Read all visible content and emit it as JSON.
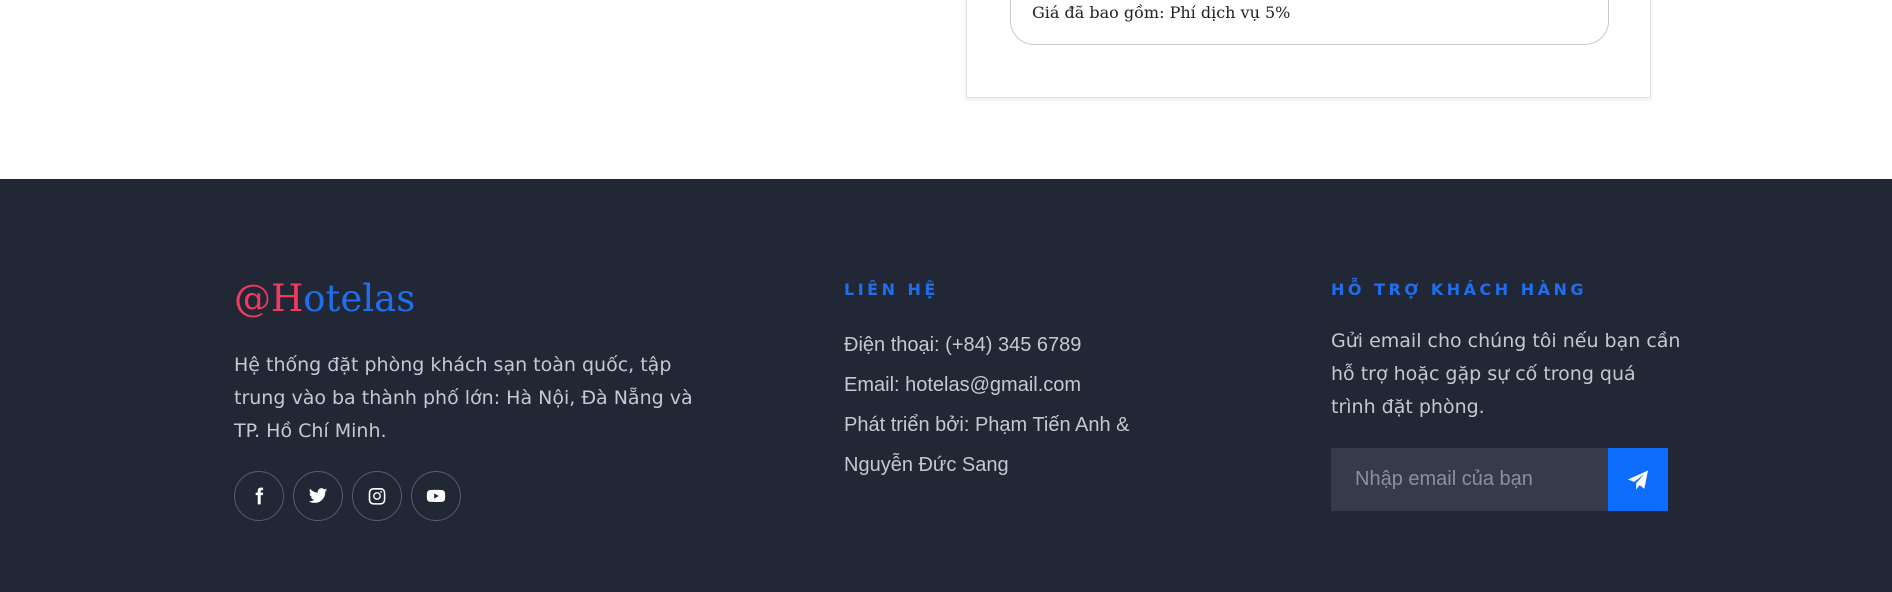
{
  "booking": {
    "price_note": "Giá đã bao gồm: Phí dịch vụ 5%"
  },
  "footer": {
    "brand": {
      "logo_part1": "@H",
      "logo_part2": "otelas",
      "description": "Hệ thống đặt phòng khách sạn toàn quốc, tập trung vào ba thành phố lớn: Hà Nội, Đà Nẵng và TP. Hồ Chí Minh.",
      "socials": [
        {
          "icon": "facebook-icon"
        },
        {
          "icon": "twitter-icon"
        },
        {
          "icon": "instagram-icon"
        },
        {
          "icon": "youtube-icon"
        }
      ]
    },
    "contact": {
      "title": "LIÊN HỆ",
      "phone": "Điện thoại: (+84) 345 6789",
      "email": "Email: hotelas@gmail.com",
      "developed_by_line1": "Phát triển bởi: Phạm Tiến Anh &",
      "developed_by_line2": "Nguyễn Đức Sang"
    },
    "support": {
      "title": "HỖ TRỢ KHÁCH HÀNG",
      "description": "Gửi email cho chúng tôi nếu bạn cần hỗ trợ hoặc gặp sự cố trong quá trình đặt phòng.",
      "email_placeholder": "Nhập email của bạn",
      "send_icon": "paper-plane-icon"
    }
  },
  "colors": {
    "footer_bg": "#222736",
    "accent_blue": "#1e6ff0",
    "logo_red": "#f03a5f",
    "button_blue": "#0d6efd"
  }
}
